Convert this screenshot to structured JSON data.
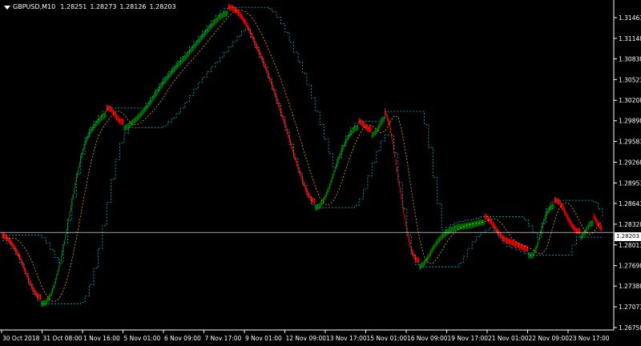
{
  "header": {
    "symbol": "GBPUSD,M10",
    "open": "1.28251",
    "high": "1.28273",
    "low": "1.28126",
    "close": "1.28203"
  },
  "current_price_label": "1.28203",
  "colors": {
    "background": "#000000",
    "up_bar": "#008000",
    "down_bar": "#ff0000",
    "outer_band": "#00bcd4",
    "inner_band": "#e6a800",
    "axis": "#ffffff"
  },
  "chart_data": {
    "type": "line",
    "price_axis_labels": [
      "1.31463",
      "1.31148",
      "1.30838",
      "1.30523",
      "1.30208",
      "1.29898",
      "1.29583",
      "1.29268",
      "1.28953",
      "1.28643",
      "1.28328",
      "1.28013",
      "1.27698",
      "1.27388",
      "1.27073",
      "1.26758"
    ],
    "time_axis_labels": [
      "30 Oct 2018",
      "31 Oct 08:00",
      "1 Nov 16:00",
      "5 Nov 01:00",
      "6 Nov 09:00",
      "7 Nov 17:00",
      "9 Nov 01:00",
      "12 Nov 09:00",
      "13 Nov 17:00",
      "15 Nov 01:00",
      "16 Nov 09:00",
      "19 Nov 17:00",
      "21 Nov 01:00",
      "22 Nov 09:00",
      "23 Nov 17:00"
    ],
    "ylim": [
      1.26758,
      1.31648
    ],
    "current_price": 1.28203,
    "series": [
      {
        "values": [
          1.2812,
          1.2808,
          1.28,
          1.279,
          1.2778,
          1.2762,
          1.2745,
          1.273,
          1.272,
          1.2716,
          1.2718,
          1.2728,
          1.2745,
          1.277,
          1.28,
          1.2835,
          1.287,
          1.2905,
          1.2935,
          1.296,
          1.2975,
          1.2985,
          1.2993,
          1.3,
          1.3005,
          1.3003,
          1.2993,
          1.2985,
          1.2983,
          1.2986,
          1.2992,
          1.2998,
          1.3005,
          1.3013,
          1.3022,
          1.3032,
          1.3042,
          1.3052,
          1.306,
          1.3068,
          1.3076,
          1.3083,
          1.309,
          1.3098,
          1.3106,
          1.3114,
          1.3122,
          1.313,
          1.3138,
          1.3145,
          1.3152,
          1.3156,
          1.3158,
          1.3156,
          1.3151,
          1.3143,
          1.3133,
          1.312,
          1.3105,
          1.309,
          1.3075,
          1.3058,
          1.304,
          1.302,
          1.3,
          1.298,
          1.2958,
          1.2936,
          1.2915,
          1.2896,
          1.2878,
          1.2866,
          1.2862,
          1.2865,
          1.2875,
          1.289,
          1.291,
          1.293,
          1.2948,
          1.2963,
          1.2975,
          1.2982,
          1.2985,
          1.298,
          1.2973,
          1.2972,
          1.2978,
          1.299,
          1.3,
          1.298,
          1.2945,
          1.29,
          1.286,
          1.282,
          1.279,
          1.2775,
          1.2772,
          1.2778,
          1.2788,
          1.28,
          1.281,
          1.2818,
          1.2824,
          1.2828,
          1.2831,
          1.2833,
          1.2834,
          1.2835,
          1.2836,
          1.2838,
          1.284,
          1.284,
          1.2835,
          1.2826,
          1.2816,
          1.2808,
          1.2803,
          1.2801,
          1.2798,
          1.2795,
          1.2792,
          1.279,
          1.279,
          1.2805,
          1.283,
          1.2852,
          1.2862,
          1.2865,
          1.2862,
          1.2852,
          1.2838,
          1.2826,
          1.2818,
          1.2817,
          1.2825,
          1.2837,
          1.284,
          1.2828,
          1.282
        ]
      }
    ]
  }
}
